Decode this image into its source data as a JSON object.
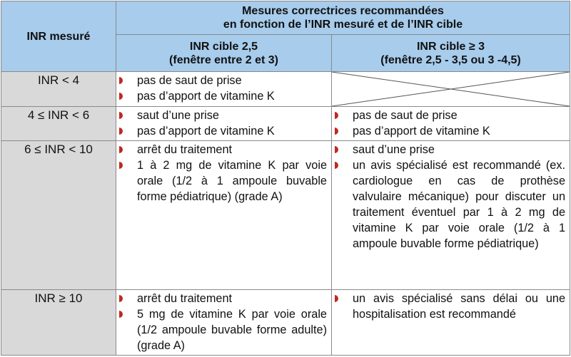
{
  "header": {
    "col_label": "INR mesuré",
    "group_line1": "Mesures correctrices recommandées",
    "group_line2": "en fonction de l’INR mesuré et de l’INR cible",
    "target_a_line1": "INR cible 2,5",
    "target_a_line2": "(fenêtre entre 2 et 3)",
    "target_b_line1": "INR cible ≥ 3",
    "target_b_line2": "(fenêtre 2,5 - 3,5 ou 3 -4,5)"
  },
  "rows": [
    {
      "label": "INR < 4",
      "a": [
        "pas de saut de prise",
        "pas d’apport de vitamine K"
      ],
      "b": []
    },
    {
      "label": "4 ≤ INR < 6",
      "a": [
        "saut d’une prise",
        "pas d’apport de vitamine K"
      ],
      "b": [
        "pas de saut de prise",
        "pas d’apport de vitamine K"
      ]
    },
    {
      "label": "6 ≤ INR < 10",
      "a": [
        "arrêt du traitement",
        "1 à 2 mg de vitamine K par voie orale (1/2 à 1 ampoule buvable forme pédiatrique) (grade A)"
      ],
      "b": [
        "saut d’une prise",
        "un avis spécialisé est recommandé (ex. cardiologue en cas de prothèse valvulaire mécanique) pour discuter un traitement éventuel par 1 à 2 mg de vitamine K par voie orale (1/2 à 1 ampoule buvable forme pédiatrique)"
      ]
    },
    {
      "label": "INR ≥ 10",
      "a": [
        "arrêt du traitement",
        "5 mg de vitamine K par voie orale (1/2 ampoule buvable forme adulte) (grade A)"
      ],
      "b": [
        "un avis spécialisé sans délai ou une hospitalisation est recommandé"
      ]
    }
  ],
  "colors": {
    "header_bg": "#a7ccec",
    "label_bg": "#d9d9d9",
    "bullet": "#c0281f",
    "border": "#8a8a8a"
  },
  "icons": {
    "bullet": "red-half-round-bullet-icon"
  }
}
